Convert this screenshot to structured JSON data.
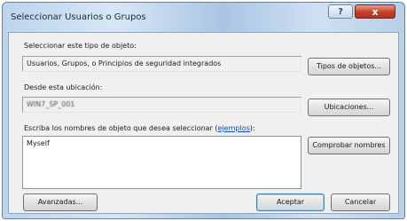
{
  "window": {
    "title": "Seleccionar Usuarios o Grupos",
    "help_label": "?",
    "close_label": "x"
  },
  "object_type": {
    "label": "Seleccionar este tipo de objeto:",
    "value": "Usuarios, Grupos, o Principios de seguridad integrados",
    "button_label": "Tipos de objetos..."
  },
  "location": {
    "label": "Desde esta ubicación:",
    "value": "WIN7_SP_001",
    "button_label": "Ubicaciones..."
  },
  "names": {
    "label_prefix": "Escriba los nombres de objeto que desea seleccionar (",
    "examples_link": "ejemplos",
    "label_suffix": "):",
    "value": "Myself",
    "check_button_label": "Comprobar nombres"
  },
  "footer": {
    "advanced_label": "Avanzadas...",
    "ok_label": "Aceptar",
    "cancel_label": "Cancelar"
  }
}
